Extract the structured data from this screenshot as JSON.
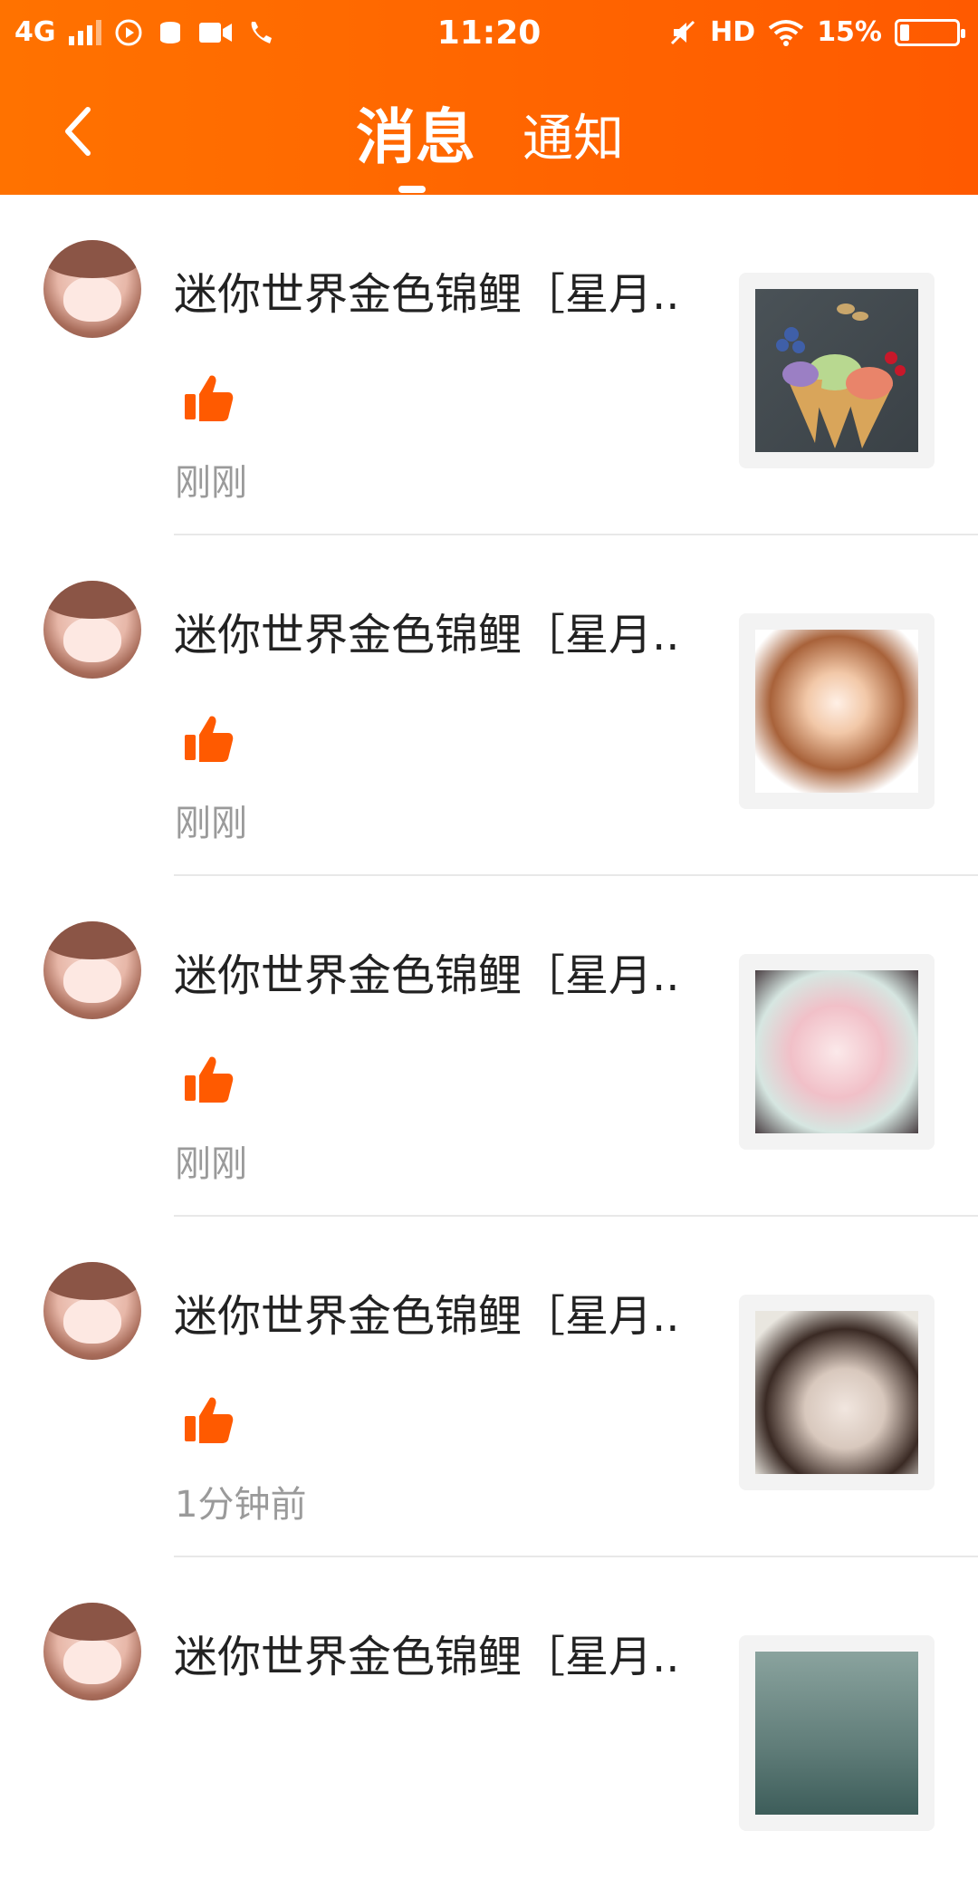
{
  "status_bar": {
    "network": "4G",
    "time": "11:20",
    "hd": "HD",
    "battery": "15%"
  },
  "nav": {
    "tab_messages": "消息",
    "tab_notices": "通知",
    "active_tab": "消息"
  },
  "items": [
    {
      "name": "迷你世界金色锦鲤［星月...",
      "time": "刚刚"
    },
    {
      "name": "迷你世界金色锦鲤［星月...",
      "time": "刚刚"
    },
    {
      "name": "迷你世界金色锦鲤［星月...",
      "time": "刚刚"
    },
    {
      "name": "迷你世界金色锦鲤［星月...",
      "time": "1分钟前"
    },
    {
      "name": "迷你世界金色锦鲤［星月...",
      "time": ""
    }
  ],
  "colors": {
    "accent": "#ff6400",
    "like": "#ff5a00",
    "muted": "#9a9a9a"
  }
}
